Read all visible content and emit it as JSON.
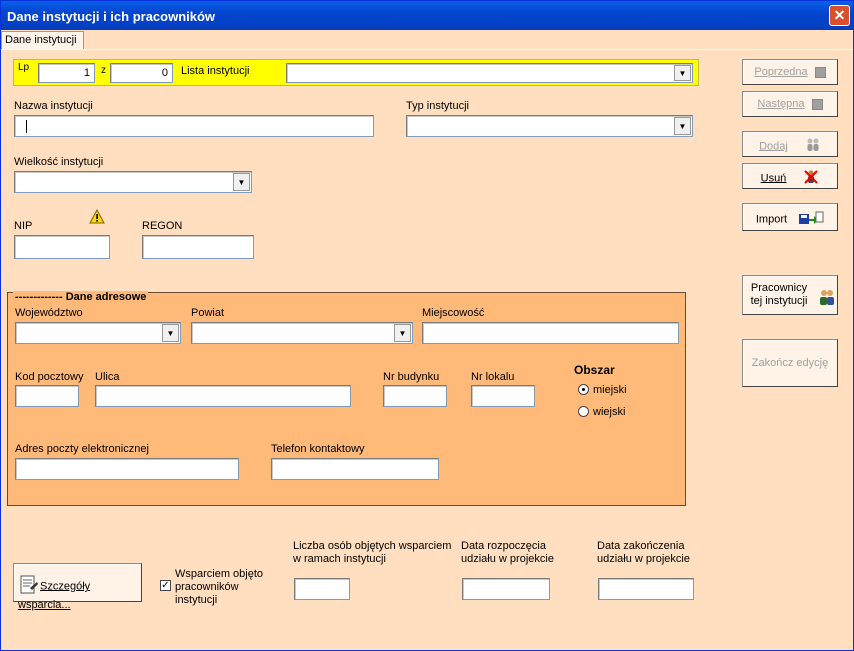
{
  "window": {
    "title": "Dane instytucji i ich pracowników",
    "close_label": "✕"
  },
  "tab": {
    "label": "Dane instytucji"
  },
  "header_bar": {
    "lp_label": "Lp",
    "lp_value": "1",
    "z_label": "z",
    "z_value": "0",
    "lista_label": "Lista instytucji",
    "lista_value": ""
  },
  "fields": {
    "nazwa_label": "Nazwa instytucji",
    "nazwa_value": "",
    "typ_label": "Typ instytucji",
    "typ_value": "",
    "wielkosc_label": "Wielkość instytucji",
    "wielkosc_value": "",
    "nip_label": "NIP",
    "nip_value": "",
    "regon_label": "REGON",
    "regon_value": ""
  },
  "address": {
    "title": "Dane adresowe",
    "wojewodztwo_label": "Województwo",
    "wojewodztwo_value": "",
    "powiat_label": "Powiat",
    "powiat_value": "",
    "miejscowosc_label": "Miejscowość",
    "miejscowosc_value": "",
    "kod_label": "Kod pocztowy",
    "kod_value": "",
    "ulica_label": "Ulica",
    "ulica_value": "",
    "budynek_label": "Nr budynku",
    "budynek_value": "",
    "lokal_label": "Nr lokalu",
    "lokal_value": "",
    "obszar_label": "Obszar",
    "obszar_options": [
      "miejski",
      "wiejski"
    ],
    "obszar_selected": "miejski",
    "email_label": "Adres poczty elektronicznej",
    "email_value": "",
    "telefon_label": "Telefon kontaktowy",
    "telefon_value": ""
  },
  "bottom": {
    "szczegoly_button": "Szczegóły wsparcia...",
    "wsparcie_checkbox_label": "Wsparciem objęto pracowników instytucji",
    "wsparcie_checked": true,
    "liczba_label": "Liczba osób objętych wsparciem w ramach instytucji",
    "liczba_value": "",
    "data_rozp_label": "Data rozpoczęcia udziału w projekcie",
    "data_rozp_value": "",
    "data_zak_label": "Data zakończenia udziału w projekcie",
    "data_zak_value": ""
  },
  "side_buttons": {
    "poprzednia": "Poprzedna",
    "nastepna": "Następna",
    "dodaj": "Dodaj",
    "usun": "Usuń",
    "import": "Import",
    "pracownicy": "Pracownicy tej instytucji",
    "zakoncz": "Zakończ edycję"
  },
  "colors": {
    "form_bg": "#ffdfbf",
    "address_bg": "#ffb979",
    "header_bar": "#ffff00",
    "title_bar": "#0546d0"
  },
  "icons": [
    "warning-icon",
    "people-icon",
    "delete-person-icon",
    "import-icon",
    "workers-icon",
    "document-icon"
  ]
}
